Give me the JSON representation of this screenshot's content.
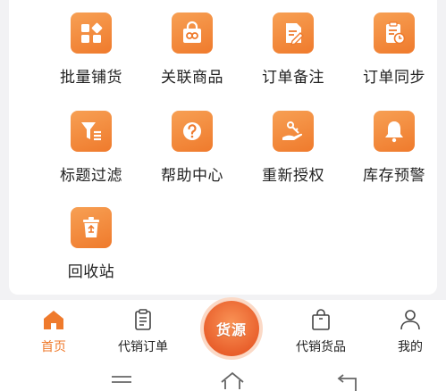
{
  "tools": [
    {
      "label": "批量铺货",
      "icon": "batch-list-icon"
    },
    {
      "label": "关联商品",
      "icon": "link-goods-bag-icon"
    },
    {
      "label": "订单备注",
      "icon": "order-note-icon"
    },
    {
      "label": "订单同步",
      "icon": "order-sync-icon"
    },
    {
      "label": "标题过滤",
      "icon": "title-filter-icon"
    },
    {
      "label": "帮助中心",
      "icon": "help-question-icon"
    },
    {
      "label": "重新授权",
      "icon": "reauthorize-hand-icon"
    },
    {
      "label": "库存预警",
      "icon": "stock-alert-bell-icon"
    },
    {
      "label": "回收站",
      "icon": "recycle-bin-icon"
    }
  ],
  "tabbar": {
    "home": "首页",
    "consign_orders": "代销订单",
    "center": "货源",
    "consign_goods": "代销货品",
    "mine": "我的"
  },
  "colors": {
    "accent": "#ef7a2c",
    "tile_gradient_start": "#f7a054",
    "tile_gradient_end": "#ef7a2c"
  }
}
